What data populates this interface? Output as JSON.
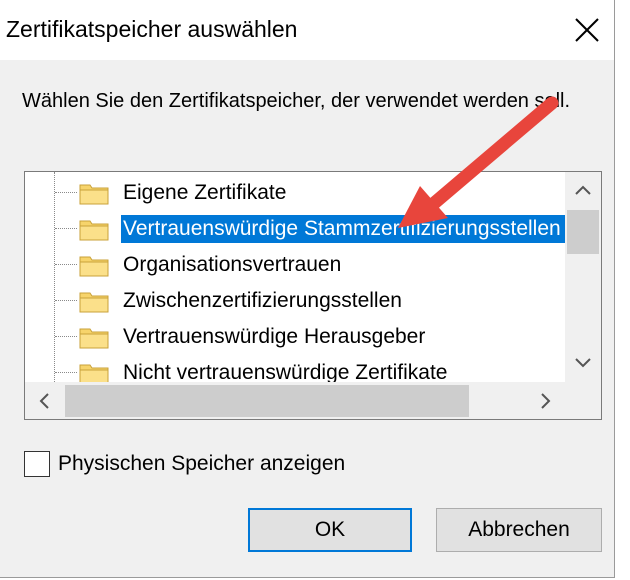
{
  "dialog": {
    "title": "Zertifikatspeicher auswählen",
    "description": "Wählen Sie den Zertifikatspeicher, der verwendet werden soll."
  },
  "tree": {
    "items": [
      {
        "label": "Eigene Zertifikate",
        "selected": false
      },
      {
        "label": "Vertrauenswürdige Stammzertifizierungsstellen",
        "selected": true
      },
      {
        "label": "Organisationsvertrauen",
        "selected": false
      },
      {
        "label": "Zwischenzertifizierungsstellen",
        "selected": false
      },
      {
        "label": "Vertrauenswürdige Herausgeber",
        "selected": false
      },
      {
        "label": "Nicht vertrauenswürdige Zertifikate",
        "selected": false
      }
    ]
  },
  "checkbox": {
    "label": "Physischen Speicher anzeigen",
    "checked": false
  },
  "buttons": {
    "ok": "OK",
    "cancel": "Abbrechen"
  },
  "colors": {
    "selection": "#0078d7",
    "annotation_arrow": "#e8453c",
    "folder": "#f7d46b"
  }
}
